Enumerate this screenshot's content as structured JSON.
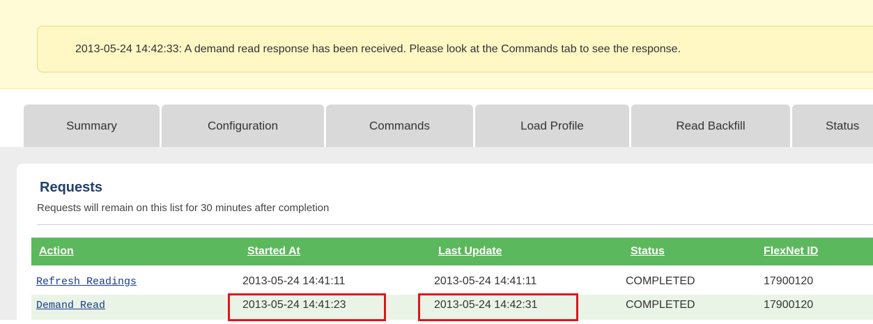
{
  "banner": {
    "message": "2013-05-24 14:42:33: A demand read response has been received. Please look at the Commands tab to see the response."
  },
  "tabs": [
    {
      "label": "Summary"
    },
    {
      "label": "Configuration"
    },
    {
      "label": "Commands"
    },
    {
      "label": "Load Profile"
    },
    {
      "label": "Read Backfill"
    },
    {
      "label": "Status"
    }
  ],
  "requests": {
    "title": "Requests",
    "subtitle": "Requests will remain on this list for 30 minutes after completion",
    "columns": [
      "Action",
      "Started At",
      "Last Update",
      "Status",
      "FlexNet ID"
    ],
    "rows": [
      {
        "action": "Refresh Readings",
        "started": "2013-05-24 14:41:11",
        "updated": "2013-05-24 14:41:11",
        "status": "COMPLETED",
        "flexnet_id": "17900120"
      },
      {
        "action": "Demand Read",
        "started": "2013-05-24 14:41:23",
        "updated": "2013-05-24 14:42:31",
        "status": "COMPLETED",
        "flexnet_id": "17900120"
      }
    ]
  },
  "colors": {
    "banner_bg": "#fffbd6",
    "table_header": "#5cb85c",
    "title_blue": "#1f3f6e",
    "highlight_red": "#e0141e"
  }
}
